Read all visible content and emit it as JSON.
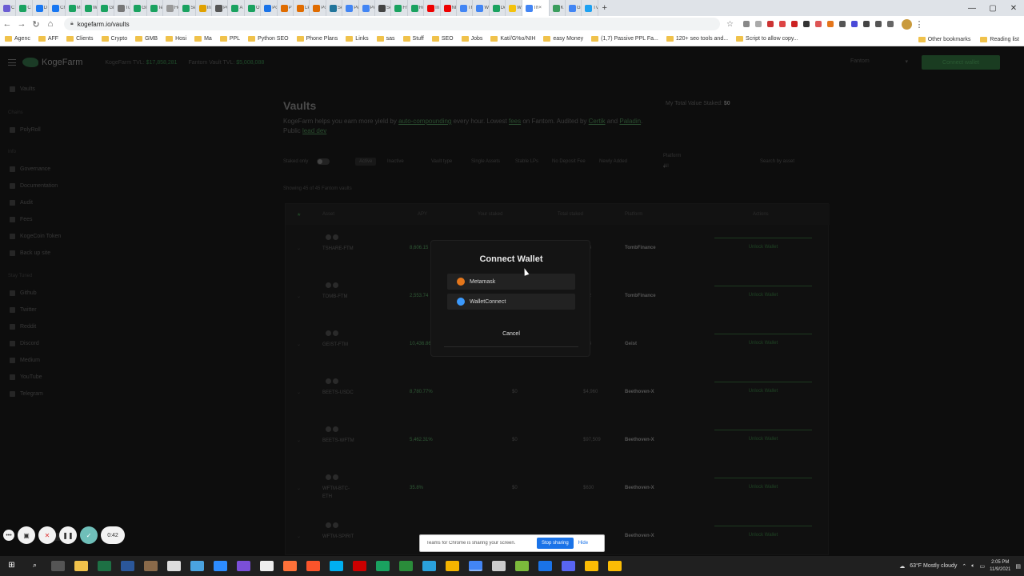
{
  "browser": {
    "tabs": [
      {
        "label": "C",
        "color": "#6b5dd3"
      },
      {
        "label": "C",
        "color": "#1aa260"
      },
      {
        "label": "D",
        "color": "#1877f2"
      },
      {
        "label": "Ch",
        "color": "#1877f2"
      },
      {
        "label": "M",
        "color": "#1aa260"
      },
      {
        "label": "W",
        "color": "#1aa260"
      },
      {
        "label": "Gl",
        "color": "#1aa260"
      },
      {
        "label": "Tu",
        "color": "#777"
      },
      {
        "label": "Gl",
        "color": "#1aa260"
      },
      {
        "label": "Te",
        "color": "#1aa260"
      },
      {
        "label": "He",
        "color": "#999"
      },
      {
        "label": "Se",
        "color": "#1aa260"
      },
      {
        "label": "Ins",
        "color": "#e0a100"
      },
      {
        "label": "Po",
        "color": "#555"
      },
      {
        "label": "A",
        "color": "#1aa260"
      },
      {
        "label": "Of",
        "color": "#1aa260"
      },
      {
        "label": "Po",
        "color": "#1a73e8"
      },
      {
        "label": "P",
        "color": "#e06c00"
      },
      {
        "label": "LP",
        "color": "#e06c00"
      },
      {
        "label": "Po",
        "color": "#e06c00"
      },
      {
        "label": "Se",
        "color": "#21759b"
      },
      {
        "label": "Pe",
        "color": "#4285f4"
      },
      {
        "label": "Pe",
        "color": "#4285f4"
      },
      {
        "label": "Se",
        "color": "#444"
      },
      {
        "label": "Fr",
        "color": "#1aa260"
      },
      {
        "label": "Re",
        "color": "#1aa260"
      },
      {
        "label": "In",
        "color": "#e00"
      },
      {
        "label": "NF",
        "color": "#e00"
      },
      {
        "label": "Th",
        "color": "#4285f4"
      },
      {
        "label": "W",
        "color": "#4285f4"
      },
      {
        "label": "De",
        "color": "#1aa260"
      },
      {
        "label": "W",
        "color": "#f4c20d"
      },
      {
        "label": "Th",
        "color": "#4285f4"
      },
      {
        "label": "K",
        "color": "#3a9d5d"
      },
      {
        "label": "Gr",
        "color": "#4285f4"
      },
      {
        "label": "Tv",
        "color": "#1da1f2"
      }
    ],
    "active_tab_close": "×",
    "new_tab": "+",
    "window_controls": [
      "—",
      "▢",
      "✕"
    ],
    "url": "kogefarm.io/vaults",
    "bookmarks": [
      "Agenc",
      "AFF",
      "Clients",
      "Crypto",
      "GMB",
      "Hosi",
      "Ma",
      "PPL",
      "Python SEO",
      "Phone Plans",
      "Links",
      "sas",
      "Stuff",
      "SEO",
      "Jobs",
      "Kat//G%o/NIH",
      "easy Money",
      "(1,7) Passive PPL Fa...",
      "120+ seo tools and...",
      "Script to allow copy..."
    ],
    "bookmarks_right": [
      "Other bookmarks",
      "Reading list"
    ]
  },
  "app": {
    "logo": "KogeFarm",
    "tvl_label": "KogeFarm TVL:",
    "tvl_value": "$17,858,281",
    "fantom_tvl_label": "Fantom Vault TVL:",
    "fantom_tvl_value": "$5,008,088",
    "network": "Fantom",
    "connect_label": "Connect wallet"
  },
  "sidebar": {
    "vaults": "Vaults",
    "chains_head": "Chains",
    "polyroll": "PolyRoll",
    "info_head": "Info",
    "links": [
      "Governance",
      "Documentation",
      "Audit",
      "Fees",
      "KogeCoin Token",
      "Back up site"
    ],
    "social_head": "Stay Tuned",
    "social": [
      "Github",
      "Twitter",
      "Reddit",
      "Discord",
      "Medium",
      "YouTube",
      "Telegram"
    ],
    "light": "Light",
    "dark": "Dark"
  },
  "main": {
    "title": "Vaults",
    "my_tvl_label": "My Total Value Staked:",
    "my_tvl_value": "$0",
    "desc_1": "KogeFarm helps you earn more yield by",
    "desc_link1": "auto-compounding",
    "desc_2": "every hour. Lowest",
    "desc_link2": "fees",
    "desc_3": "on Fantom. Audited by",
    "desc_link3": "Certik",
    "desc_4": "and",
    "desc_link4": "Paladin",
    "desc_5": ". Public",
    "desc_link5": "lead dev",
    "filters": {
      "staked_only": "Staked only",
      "active": "Active",
      "inactive": "Inactive",
      "vault_type": "Vault type",
      "single": "Single Assets",
      "stable": "Stable LPs",
      "nodeposit": "No Deposit Fee",
      "new": "Newly Added",
      "platform_label": "Platform",
      "platform_value": "All",
      "search": "Search by asset"
    },
    "showing": "Showing 45 of 45 Fantom vaults",
    "columns": [
      "Asset",
      "APY",
      "Your staked",
      "Total staked",
      "Platform",
      "Actions"
    ],
    "rows": [
      {
        "name": "TSHARE-FTM",
        "apy": "8,606.15",
        "staked": "",
        "total": "608",
        "platform": "TombFinance",
        "action": "Unlock Wallet"
      },
      {
        "name": "TOMB-FTM",
        "apy": "2,553.74",
        "staked": "",
        "total": "752",
        "platform": "TombFinance",
        "action": "Unlock Wallet"
      },
      {
        "name": "GEIST-FTM",
        "apy": "10,436.86",
        "staked": "",
        "total": "308",
        "platform": "Geist",
        "action": "Unlock Wallet"
      },
      {
        "name": "BEETS-USDC",
        "apy": "8,780.77%",
        "staked": "$0",
        "total": "$4,960",
        "platform": "Beethoven-X",
        "action": "Unlock Wallet"
      },
      {
        "name": "BEETS-WFTM",
        "apy": "5,462.31%",
        "staked": "$0",
        "total": "$97,509",
        "platform": "Beethoven-X",
        "action": "Unlock Wallet"
      },
      {
        "name": "WFTM-BTC-ETH",
        "apy": "35.8%",
        "staked": "$0",
        "total": "$630",
        "platform": "Beethoven-X",
        "action": "Unlock Wallet"
      },
      {
        "name": "WFTM-SPIRIT",
        "apy": "",
        "staked": "",
        "total": "",
        "platform": "Beethoven-X",
        "action": "Unlock Wallet"
      }
    ]
  },
  "modal": {
    "title": "Connect Wallet",
    "metamask": "Metamask",
    "walletconnect": "WalletConnect",
    "cancel": "Cancel"
  },
  "recorder": {
    "time": "0:42"
  },
  "share": {
    "message": "Teams for Chrome is sharing your screen.",
    "stop": "Stop sharing",
    "hide": "Hide"
  },
  "taskbar": {
    "weather": "63°F Mostly cloudy",
    "time": "2:05 PM",
    "date": "11/9/2021"
  }
}
